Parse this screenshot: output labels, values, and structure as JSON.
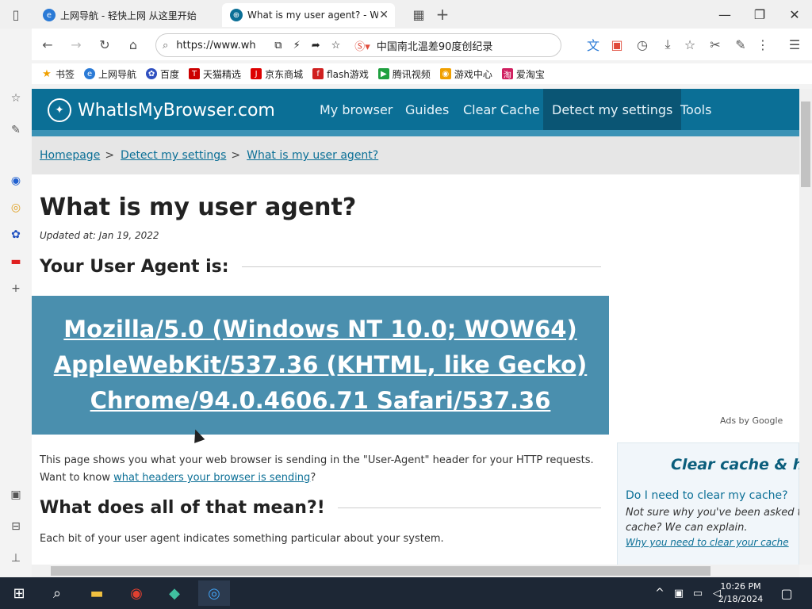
{
  "browser": {
    "tabs": [
      {
        "label": "上网导航 - 轻快上网 从这里开始",
        "active": false
      },
      {
        "label": "What is my user agent? - What",
        "active": true
      }
    ],
    "new_tab_label": "+",
    "url": "https://www.wh",
    "search_suggestion": "中国南北温差90度创纪录",
    "bookmarks": [
      "书签",
      "上网导航",
      "百度",
      "天猫精选",
      "京东商城",
      "flash游戏",
      "腾讯视频",
      "游戏中心",
      "爱淘宝"
    ]
  },
  "site": {
    "logo_text": "WhatIsMyBrowser.com",
    "nav": [
      "My browser",
      "Guides",
      "Clear Cache",
      "Detect my settings",
      "Tools"
    ],
    "active_nav": "Detect my settings",
    "breadcrumbs": [
      "Homepage",
      "Detect my settings",
      "What is my user agent?"
    ],
    "page_title": "What is my user agent?",
    "updated": "Updated at: Jan 19, 2022",
    "h2_ua": "Your User Agent is:",
    "user_agent": "Mozilla/5.0 (Windows NT 10.0; WOW64) AppleWebKit/537.36 (KHTML, like Gecko) Chrome/94.0.4606.71 Safari/537.36",
    "intro_line1": "This page shows you what your web browser is sending in the \"User-Agent\" header for your HTTP requests.",
    "intro_line2_prefix": "Want to know ",
    "intro_link": "what headers your browser is sending",
    "intro_line2_suffix": "?",
    "h2_meaning": "What does all of that mean?!",
    "meaning_text": "Each bit of your user agent indicates something particular about your system.",
    "ads_label": "Ads by Google",
    "sidebox": {
      "title": "Clear cache & his",
      "question": "Do I need to clear my cache?",
      "desc": "Not sure why you've been asked to cache? We can explain.",
      "link": "Why you need to clear your cache"
    }
  },
  "taskbar": {
    "time": "10:26 PM",
    "date": "2/18/2024"
  },
  "colors": {
    "nav_bg": "#0b6f96",
    "ua_box_bg": "#4a8fae",
    "link": "#0b6f96"
  }
}
